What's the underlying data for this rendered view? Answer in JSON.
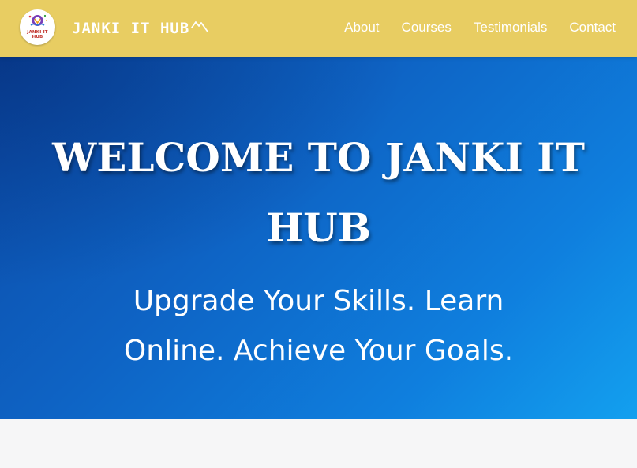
{
  "header": {
    "logo": {
      "line1": "JANKI IT",
      "line2": "HUB",
      "icon": "bulb-book-logo-icon"
    },
    "brand": "JANKI IT HUB",
    "nav": [
      {
        "label": "About"
      },
      {
        "label": "Courses"
      },
      {
        "label": "Testimonials"
      },
      {
        "label": "Contact"
      }
    ]
  },
  "hero": {
    "title_line1": "WELCOME TO JANKI IT",
    "title_line2": "HUB",
    "subtitle_line1": "Upgrade Your Skills. Learn",
    "subtitle_line2": "Online. Achieve Your Goals."
  },
  "colors": {
    "header_bg": "#e8cd62",
    "hero_gradient_start": "#0b4aa6",
    "hero_gradient_end": "#13a0ef",
    "text": "#ffffff",
    "page_bg": "#f6f6f7"
  }
}
